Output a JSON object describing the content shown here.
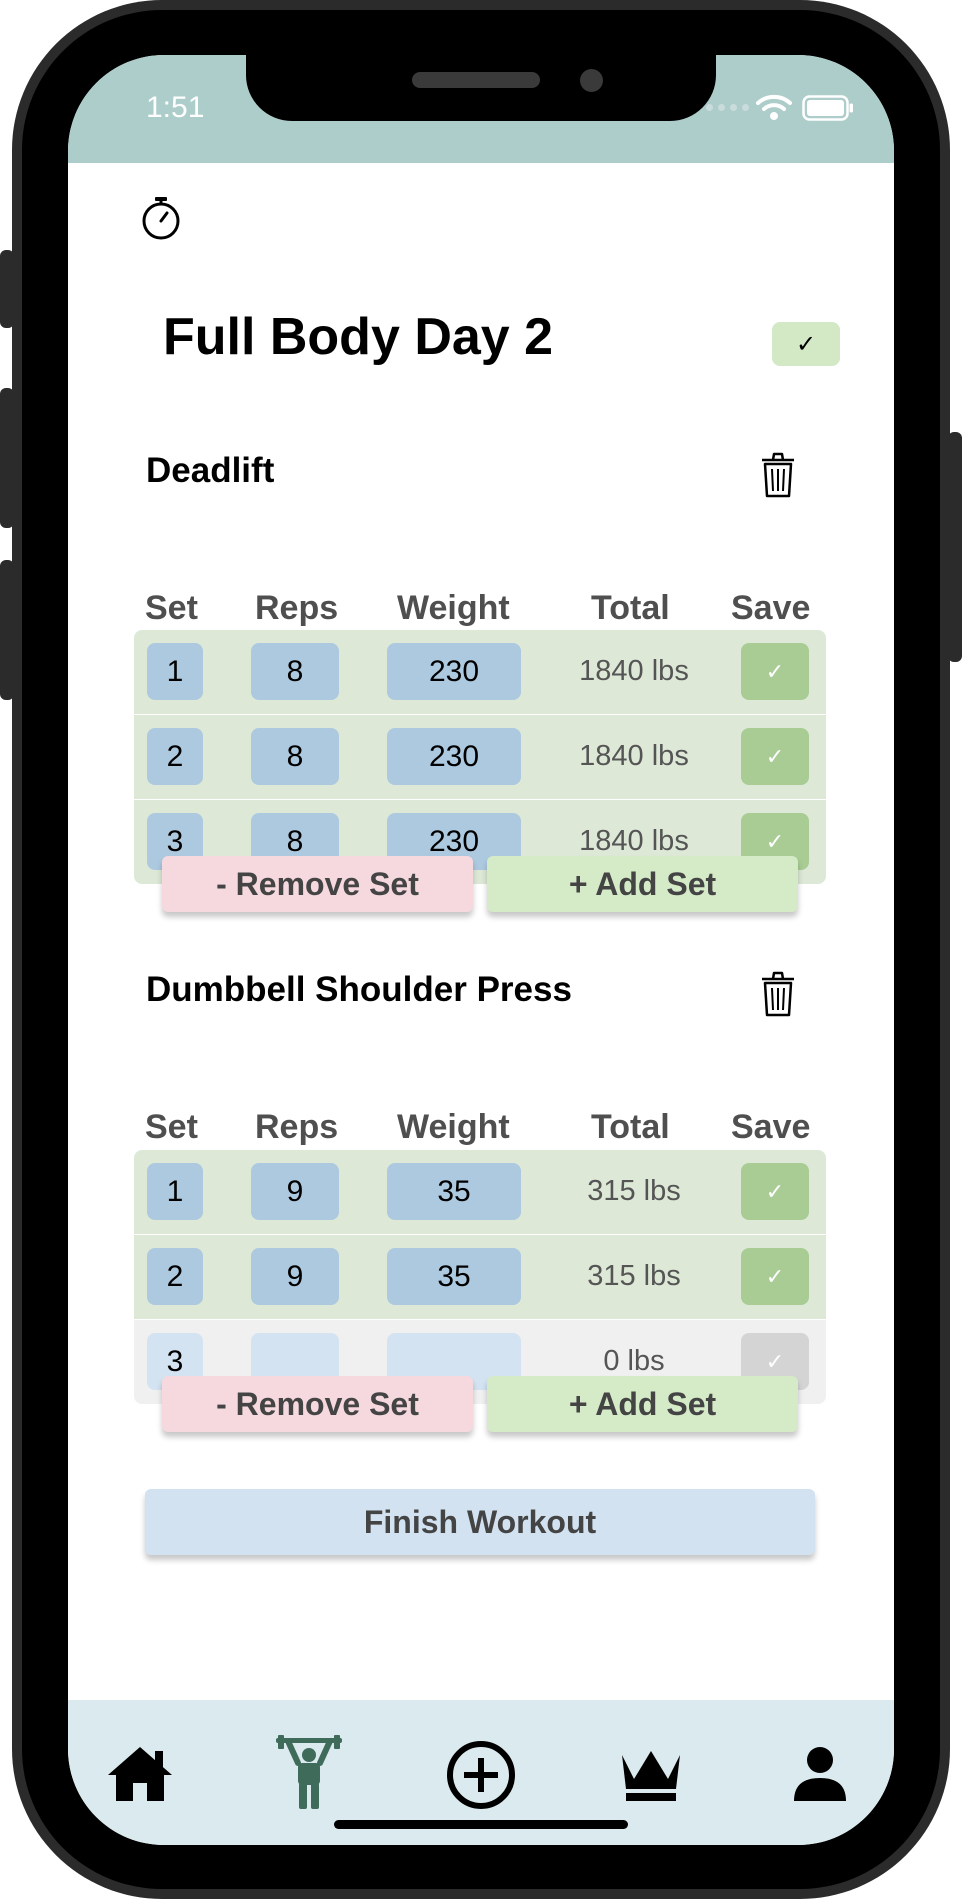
{
  "status_bar": {
    "time": "1:51"
  },
  "workout": {
    "title": "Full Body Day 2",
    "complete_label": "✓"
  },
  "table_headers": {
    "set": "Set",
    "reps": "Reps",
    "weight": "Weight",
    "total": "Total",
    "save": "Save"
  },
  "exercises": [
    {
      "name": "Deadlift",
      "sets": [
        {
          "set": "1",
          "reps": "8",
          "weight": "230",
          "total": "1840 lbs",
          "saved": true
        },
        {
          "set": "2",
          "reps": "8",
          "weight": "230",
          "total": "1840 lbs",
          "saved": true
        },
        {
          "set": "3",
          "reps": "8",
          "weight": "230",
          "total": "1840 lbs",
          "saved": true
        }
      ]
    },
    {
      "name": "Dumbbell Shoulder Press",
      "sets": [
        {
          "set": "1",
          "reps": "9",
          "weight": "35",
          "total": "315 lbs",
          "saved": true
        },
        {
          "set": "2",
          "reps": "9",
          "weight": "35",
          "total": "315 lbs",
          "saved": true
        },
        {
          "set": "3",
          "reps": "",
          "weight": "",
          "total": "0 lbs",
          "saved": false
        }
      ]
    }
  ],
  "buttons": {
    "remove_set": "- Remove Set",
    "add_set": "+ Add Set",
    "finish": "Finish Workout",
    "save_check": "✓"
  },
  "tabbar": {
    "items": [
      "home-icon",
      "weightlifter-icon",
      "add-circle-icon",
      "crown-icon",
      "profile-icon"
    ],
    "active": "weightlifter-icon"
  },
  "colors": {
    "status_bar": "#adcdcb",
    "saved_row": "#dde9d6",
    "input_saved": "#adc9e0",
    "save_saved": "#a9cc94",
    "save_unsaved": "#d4d4d4",
    "remove": "#f5d9de",
    "add": "#d5eac7",
    "finish": "#d2e2f1",
    "tabbar": "#dbeaee",
    "active_tab": "#3f6b5b"
  }
}
